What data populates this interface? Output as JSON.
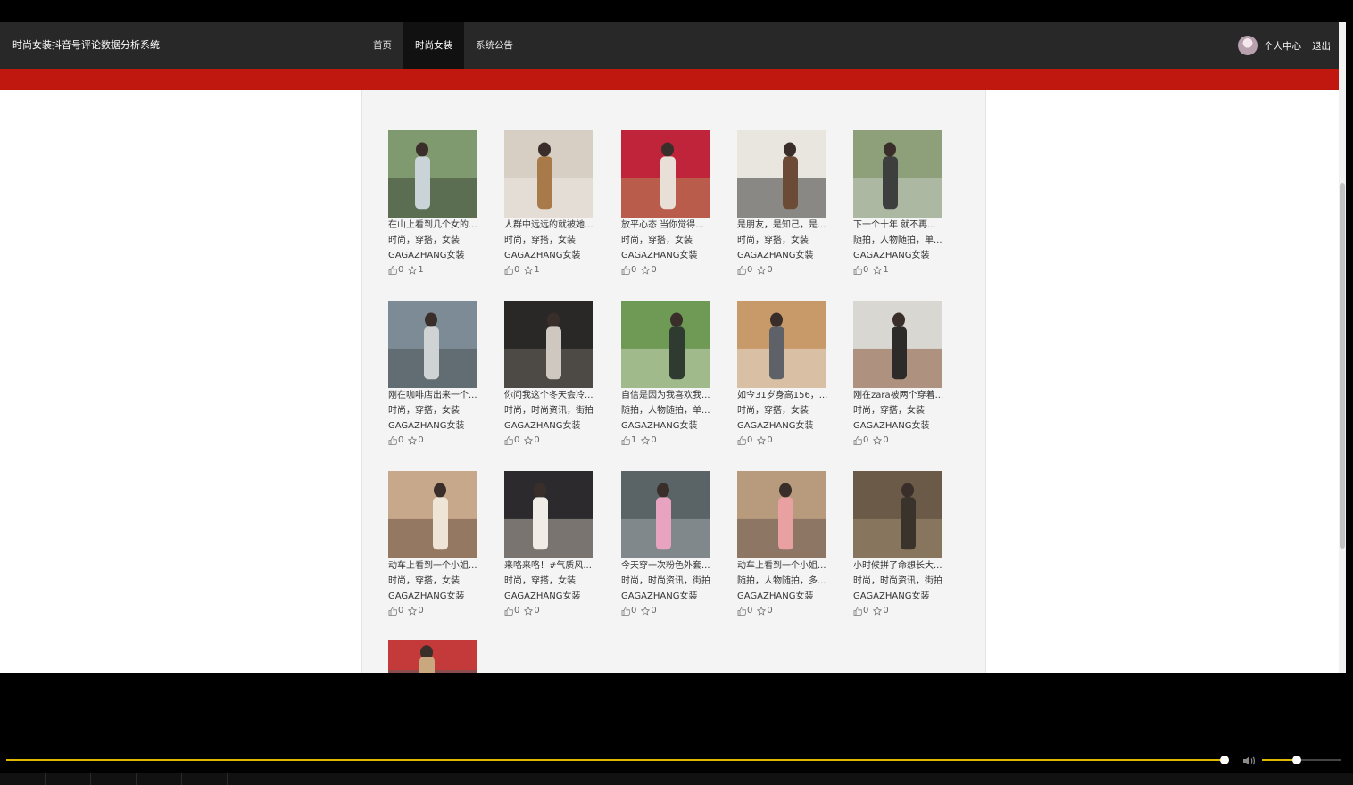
{
  "header": {
    "title": "时尚女装抖音号评论数据分析系统",
    "nav": [
      {
        "label": "首页",
        "active": false
      },
      {
        "label": "时尚女装",
        "active": true
      },
      {
        "label": "系统公告",
        "active": false
      }
    ],
    "user_center": "个人中心",
    "logout": "退出"
  },
  "colors": {
    "topbar": "#282828",
    "accent_bar": "#c0170e",
    "progress": "#e0b800"
  },
  "products": [
    {
      "title": "在山上看到几个女的...",
      "tags": "时尚，穿搭，女装",
      "author": "GAGAZHANG女装",
      "likes": "0",
      "favorites": "1"
    },
    {
      "title": "人群中远远的就被她...",
      "tags": "时尚，穿搭，女装",
      "author": "GAGAZHANG女装",
      "likes": "0",
      "favorites": "1"
    },
    {
      "title": "放平心态 当你觉得...",
      "tags": "时尚，穿搭，女装",
      "author": "GAGAZHANG女装",
      "likes": "0",
      "favorites": "0"
    },
    {
      "title": "是朋友，是知己，是...",
      "tags": "时尚，穿搭，女装",
      "author": "GAGAZHANG女装",
      "likes": "0",
      "favorites": "0"
    },
    {
      "title": "下一个十年 就不再...",
      "tags": "随拍，人物随拍，单...",
      "author": "GAGAZHANG女装",
      "likes": "0",
      "favorites": "1"
    },
    {
      "title": "刚在咖啡店出来一个...",
      "tags": "时尚，穿搭，女装",
      "author": "GAGAZHANG女装",
      "likes": "0",
      "favorites": "0"
    },
    {
      "title": "你问我这个冬天会冷...",
      "tags": "时尚，时尚资讯，街拍",
      "author": "GAGAZHANG女装",
      "likes": "0",
      "favorites": "0"
    },
    {
      "title": "自信是因为我喜欢我...",
      "tags": "随拍，人物随拍，单...",
      "author": "GAGAZHANG女装",
      "likes": "1",
      "favorites": "0"
    },
    {
      "title": "如今31岁身高156，...",
      "tags": "时尚，穿搭，女装",
      "author": "GAGAZHANG女装",
      "likes": "0",
      "favorites": "0"
    },
    {
      "title": "刚在zara被两个穿着...",
      "tags": "时尚，穿搭，女装",
      "author": "GAGAZHANG女装",
      "likes": "0",
      "favorites": "0"
    },
    {
      "title": "动车上看到一个小姐...",
      "tags": "时尚，穿搭，女装",
      "author": "GAGAZHANG女装",
      "likes": "0",
      "favorites": "0"
    },
    {
      "title": "来咯来咯！#气质风...",
      "tags": "时尚，穿搭，女装",
      "author": "GAGAZHANG女装",
      "likes": "0",
      "favorites": "0"
    },
    {
      "title": "今天穿一次粉色外套...",
      "tags": "时尚，时尚资讯，街拍",
      "author": "GAGAZHANG女装",
      "likes": "0",
      "favorites": "0"
    },
    {
      "title": "动车上看到一个小姐...",
      "tags": "随拍，人物随拍，多...",
      "author": "GAGAZHANG女装",
      "likes": "0",
      "favorites": "0"
    },
    {
      "title": "小时候拼了命想长大...",
      "tags": "时尚，时尚资讯，街拍",
      "author": "GAGAZHANG女装",
      "likes": "0",
      "favorites": "0"
    },
    {
      "title": "",
      "tags": "",
      "author": "",
      "likes": "",
      "favorites": ""
    }
  ],
  "player": {
    "progress": 0.998,
    "volume": 0.45
  }
}
